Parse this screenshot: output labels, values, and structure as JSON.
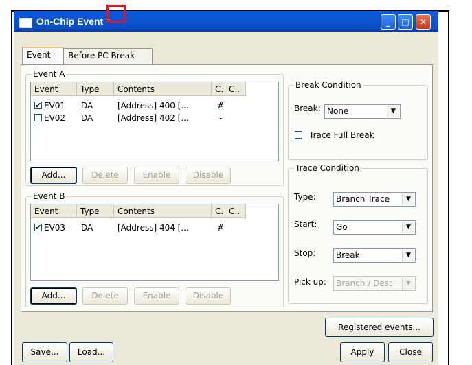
{
  "window": {
    "title": "On-Chip Event",
    "modified_marker": "*"
  },
  "titlebar_buttons": {
    "minimize": "_",
    "maximize": "□",
    "close": "✕"
  },
  "tabs": [
    {
      "label": "Event",
      "active": true
    },
    {
      "label": "Before PC Break",
      "active": false
    }
  ],
  "event_a": {
    "group_label": "Event A",
    "columns": [
      "Event",
      "Type",
      "Contents",
      "C.",
      "C.."
    ],
    "rows": [
      {
        "checked": true,
        "event": "EV01",
        "type": "DA",
        "contents": "[Address] 400 [...",
        "c": "#"
      },
      {
        "checked": false,
        "event": "EV02",
        "type": "DA",
        "contents": "[Address] 402 [...",
        "c": "-"
      }
    ],
    "buttons": {
      "add": "Add...",
      "delete": "Delete",
      "enable": "Enable",
      "disable": "Disable"
    }
  },
  "event_b": {
    "group_label": "Event B",
    "columns": [
      "Event",
      "Type",
      "Contents",
      "C.",
      "C.."
    ],
    "rows": [
      {
        "checked": true,
        "event": "EV03",
        "type": "DA",
        "contents": "[Address] 404 [...",
        "c": "#"
      }
    ],
    "buttons": {
      "add": "Add...",
      "delete": "Delete",
      "enable": "Enable",
      "disable": "Disable"
    }
  },
  "break_condition": {
    "group_label": "Break Condition",
    "break_label": "Break:",
    "break_value": "None",
    "trace_full_break": "Trace Full Break",
    "trace_full_break_checked": false
  },
  "trace_condition": {
    "group_label": "Trace Condition",
    "type_label": "Type:",
    "type_value": "Branch Trace",
    "start_label": "Start:",
    "start_value": "Go",
    "stop_label": "Stop:",
    "stop_value": "Break",
    "pickup_label": "Pick up:",
    "pickup_value": "Branch / Dest"
  },
  "footer": {
    "registered_events": "Registered events...",
    "save": "Save...",
    "load": "Load...",
    "apply": "Apply",
    "close": "Close"
  },
  "colors": {
    "titlebar": "#0a55d3",
    "highlight": "#e8121b",
    "face": "#ece9d8"
  }
}
